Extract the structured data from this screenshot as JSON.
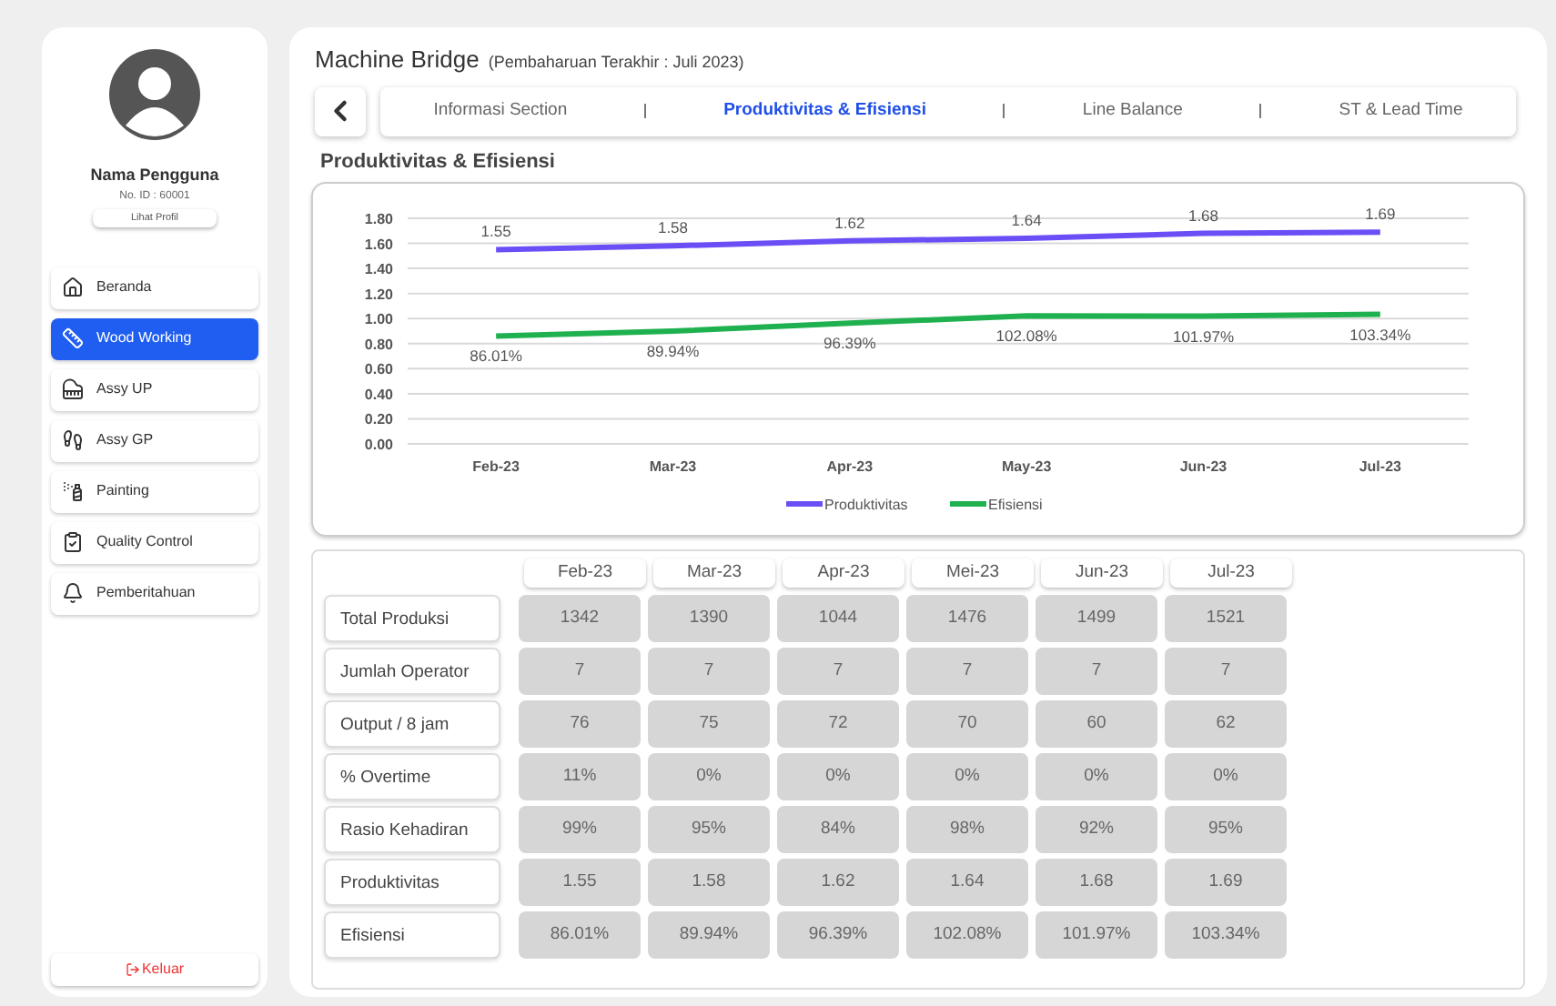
{
  "profile": {
    "name": "Nama Pengguna",
    "id": "No. ID : 60001",
    "button": "Lihat Profil"
  },
  "menu": [
    {
      "label": "Beranda",
      "selected": false
    },
    {
      "label": "Wood Working",
      "selected": true
    },
    {
      "label": "Assy UP",
      "selected": false
    },
    {
      "label": "Assy GP",
      "selected": false
    },
    {
      "label": "Painting",
      "selected": false
    },
    {
      "label": "Quality Control",
      "selected": false
    },
    {
      "label": "Pemberitahuan",
      "selected": false
    }
  ],
  "logout": "Keluar",
  "header": {
    "title": "Machine Bridge",
    "subtitle": "(Pembaharuan Terakhir : Juli 2023)"
  },
  "tabs": [
    {
      "label": "Informasi Section",
      "selected": false
    },
    {
      "label": "Produktivitas & Efisiensi",
      "selected": true
    },
    {
      "label": "Line Balance",
      "selected": false
    },
    {
      "label": "ST & Lead Time",
      "selected": false
    }
  ],
  "section_title": "Produktivitas & Efisiensi",
  "chart_data": {
    "type": "line",
    "categories": [
      "Feb-23",
      "Mar-23",
      "Apr-23",
      "May-23",
      "Jun-23",
      "Jul-23"
    ],
    "ylim": [
      0,
      1.8
    ],
    "yticks": [
      {
        "value": 0,
        "label": "0.00"
      },
      {
        "value": 0.2,
        "label": "0.20"
      },
      {
        "value": 0.4,
        "label": "0.40"
      },
      {
        "value": 0.6,
        "label": "0.60"
      },
      {
        "value": 0.8,
        "label": "0.80"
      },
      {
        "value": 1,
        "label": "1.00"
      },
      {
        "value": 1.2,
        "label": "1.20"
      },
      {
        "value": 1.4,
        "label": "1.40"
      },
      {
        "value": 1.6,
        "label": "1.60"
      },
      {
        "value": 1.8,
        "label": "1.80"
      }
    ],
    "data_labels": true,
    "grid": true,
    "legend": true,
    "series": [
      {
        "name": "Produktivitas",
        "color": "#6b4ef5",
        "values": [
          1.55,
          1.58,
          1.62,
          1.64,
          1.68,
          1.69
        ],
        "value_labels": [
          "1.55",
          "1.58",
          "1.62",
          "1.64",
          "1.68",
          "1.69"
        ]
      },
      {
        "name": "Efisiensi",
        "color": "#1fb14f",
        "values": [
          0.8601,
          0.8994,
          0.9639,
          1.0208,
          1.0197,
          1.0334
        ],
        "value_labels": [
          "86.01%",
          "89.94%",
          "96.39%",
          "102.08%",
          "101.97%",
          "103.34%"
        ]
      }
    ]
  },
  "table": {
    "columns": [
      "Feb-23",
      "Mar-23",
      "Apr-23",
      "Mei-23",
      "Jun-23",
      "Jul-23"
    ],
    "rows": [
      {
        "label": "Total Produksi",
        "cells": [
          "1342",
          "1390",
          "1044",
          "1476",
          "1499",
          "1521"
        ]
      },
      {
        "label": "Jumlah Operator",
        "cells": [
          "7",
          "7",
          "7",
          "7",
          "7",
          "7"
        ]
      },
      {
        "label": "Output / 8 jam",
        "cells": [
          "76",
          "75",
          "72",
          "70",
          "60",
          "62"
        ]
      },
      {
        "label": "% Overtime",
        "cells": [
          "11%",
          "0%",
          "0%",
          "0%",
          "0%",
          "0%"
        ]
      },
      {
        "label": "Rasio Kehadiran",
        "cells": [
          "99%",
          "95%",
          "84%",
          "98%",
          "92%",
          "95%"
        ]
      },
      {
        "label": "Produktivitas",
        "cells": [
          "1.55",
          "1.58",
          "1.62",
          "1.64",
          "1.68",
          "1.69"
        ]
      },
      {
        "label": "Efisiensi",
        "cells": [
          "86.01%",
          "89.94%",
          "96.39%",
          "102.08%",
          "101.97%",
          "103.34%"
        ]
      }
    ]
  }
}
